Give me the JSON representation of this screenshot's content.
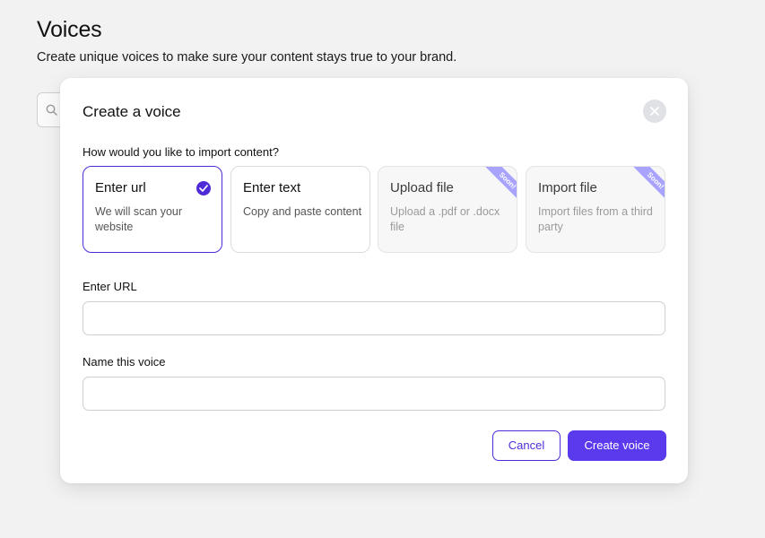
{
  "page": {
    "title": "Voices",
    "subtitle": "Create unique voices to make sure your content stays true to your brand."
  },
  "background": {
    "search_icon": "search-icon"
  },
  "modal": {
    "title": "Create a voice",
    "close_icon": "close-icon",
    "question": "How would you like to import content?",
    "options": [
      {
        "title": "Enter url",
        "description": "We will scan your website",
        "selected": true,
        "disabled": false,
        "badge": ""
      },
      {
        "title": "Enter text",
        "description": "Copy and paste content",
        "selected": false,
        "disabled": false,
        "badge": ""
      },
      {
        "title": "Upload file",
        "description": "Upload a .pdf or .docx file",
        "selected": false,
        "disabled": true,
        "badge": "Soon!"
      },
      {
        "title": "Import file",
        "description": "Import files from a third party",
        "selected": false,
        "disabled": true,
        "badge": "Soon!"
      }
    ],
    "url_field": {
      "label": "Enter URL",
      "value": "",
      "placeholder": ""
    },
    "name_field": {
      "label": "Name this voice",
      "value": "",
      "placeholder": ""
    },
    "cancel_label": "Cancel",
    "create_label": "Create voice"
  },
  "colors": {
    "accent": "#4f2bd8",
    "primary_button": "#5b3aee",
    "badge": "#a7a3ff",
    "background": "#f2f2f2"
  }
}
